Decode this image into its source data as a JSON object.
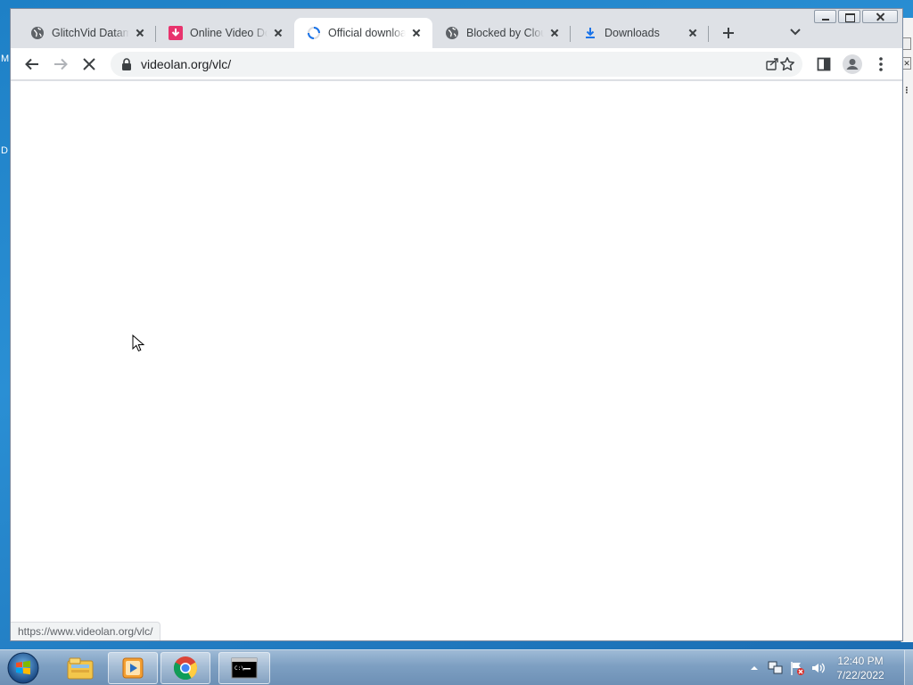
{
  "browser": {
    "tabs": [
      {
        "title": "GlitchVid Datamosh",
        "icon": "globe-icon",
        "active": false
      },
      {
        "title": "Online Video Downloader",
        "icon": "pink-download-icon",
        "active": false
      },
      {
        "title": "Official download of VLC",
        "icon": "loading-spinner-icon",
        "active": true
      },
      {
        "title": "Blocked by Cloudflare",
        "icon": "globe-icon",
        "active": false
      },
      {
        "title": "Downloads",
        "icon": "download-arrow-icon",
        "active": false
      }
    ],
    "address": {
      "url": "videolan.org/vlc/"
    },
    "status_url": "https://www.videolan.org/vlc/"
  },
  "desktop": {
    "edge_letters": [
      "M",
      "D"
    ]
  },
  "taskbar": {
    "apps": [
      "windows-explorer",
      "media-player",
      "google-chrome",
      "command-prompt"
    ],
    "clock": {
      "time": "12:40 PM",
      "date": "7/22/2022"
    }
  },
  "colors": {
    "tabstrip_bg": "#dee1e6",
    "accent_blue": "#1a73e8",
    "taskbar": "#7d9fc2"
  }
}
